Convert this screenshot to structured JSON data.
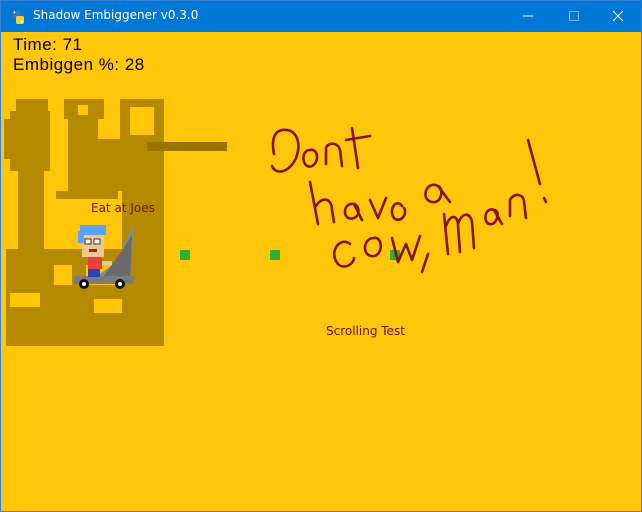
{
  "window": {
    "title": "Shadow Embiggener v0.3.0",
    "icon": "python-icon",
    "controls": [
      "minimize-icon",
      "maximize-icon",
      "close-icon"
    ]
  },
  "hud": {
    "time_label": "Time: 71",
    "embiggen_label": "Embiggen %: 28"
  },
  "scene": {
    "labels": {
      "joes": "Eat at Joes",
      "scrolling": "Scrolling Test"
    },
    "handwritten_note": "Dont have a cow, man!",
    "pickups_count": 3
  },
  "colors": {
    "background": "#ffc60a",
    "shadow": "#b58a00",
    "bar": "#9a7400",
    "pickup": "#2fae33",
    "label": "#7a1010",
    "scribble": "#8b1010",
    "titlebar": "#0078d7"
  }
}
